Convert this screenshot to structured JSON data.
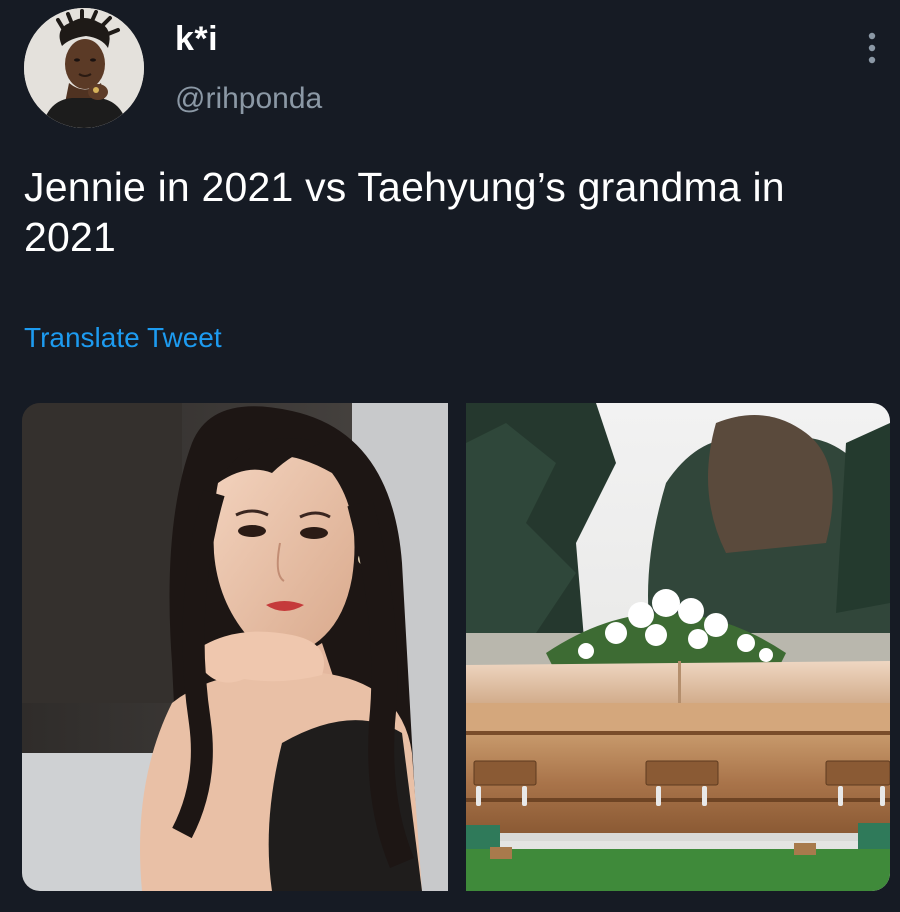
{
  "user": {
    "display_name": "k*i",
    "handle": "@rihponda"
  },
  "tweet": {
    "text": "Jennie in 2021 vs Taehyung’s grandma in 2021",
    "translate_label": "Translate Tweet"
  },
  "icons": {
    "more": "more-vertical-icon"
  },
  "colors": {
    "background": "#161b24",
    "text_primary": "#ffffff",
    "text_secondary": "#8b98a5",
    "link": "#1d9bf0"
  }
}
